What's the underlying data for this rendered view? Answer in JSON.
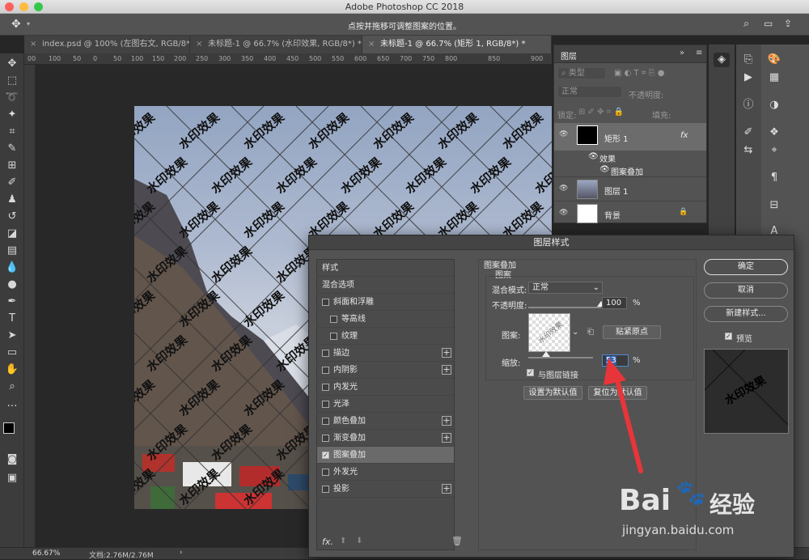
{
  "app": {
    "title": "Adobe Photoshop CC 2018",
    "hint": "点按并拖移可调整图案的位置。"
  },
  "tabs": [
    {
      "label": "index.psd @ 100% (左图右文, RGB/8*)"
    },
    {
      "label": "未标题-1 @ 66.7% (水印效果, RGB/8*) *"
    },
    {
      "label": "未标题-1 @ 66.7% (矩形 1, RGB/8*) *"
    }
  ],
  "ruler": [
    "00",
    "100",
    "50",
    "0",
    "50",
    "100",
    "150",
    "200",
    "250",
    "300",
    "350",
    "400",
    "450",
    "500",
    "550",
    "600",
    "650",
    "700",
    "750",
    "800",
    "850",
    "900"
  ],
  "watermark_text": "水印效果",
  "layers_panel": {
    "title": "图层",
    "filter_label": "类型",
    "blend_mode": "正常",
    "opacity_label": "不透明度:",
    "lock_label": "锁定:",
    "fill_label": "填充:",
    "fx_label": "fx",
    "layers": [
      {
        "name": "矩形 1"
      },
      {
        "name": "效果"
      },
      {
        "name": "图案叠加"
      },
      {
        "name": "图层 1"
      },
      {
        "name": "背景"
      }
    ]
  },
  "status": {
    "zoom": "66.67%",
    "doc": "文档:2.76M/2.76M"
  },
  "dialog": {
    "title": "图层样式",
    "styles": [
      {
        "label": "样式",
        "checkbox": false,
        "plus": false,
        "checked": false,
        "indent": 0
      },
      {
        "label": "混合选项",
        "checkbox": false,
        "plus": false,
        "checked": false,
        "indent": 0
      },
      {
        "label": "斜面和浮雕",
        "checkbox": true,
        "plus": false,
        "checked": false,
        "indent": 0
      },
      {
        "label": "等高线",
        "checkbox": true,
        "plus": false,
        "checked": false,
        "indent": 1
      },
      {
        "label": "纹理",
        "checkbox": true,
        "plus": false,
        "checked": false,
        "indent": 1
      },
      {
        "label": "描边",
        "checkbox": true,
        "plus": true,
        "checked": false,
        "indent": 0
      },
      {
        "label": "内阴影",
        "checkbox": true,
        "plus": true,
        "checked": false,
        "indent": 0
      },
      {
        "label": "内发光",
        "checkbox": true,
        "plus": false,
        "checked": false,
        "indent": 0
      },
      {
        "label": "光泽",
        "checkbox": true,
        "plus": false,
        "checked": false,
        "indent": 0
      },
      {
        "label": "颜色叠加",
        "checkbox": true,
        "plus": true,
        "checked": false,
        "indent": 0
      },
      {
        "label": "渐变叠加",
        "checkbox": true,
        "plus": true,
        "checked": false,
        "indent": 0
      },
      {
        "label": "图案叠加",
        "checkbox": true,
        "plus": false,
        "checked": true,
        "indent": 0,
        "selected": true
      },
      {
        "label": "外发光",
        "checkbox": true,
        "plus": false,
        "checked": false,
        "indent": 0
      },
      {
        "label": "投影",
        "checkbox": true,
        "plus": true,
        "checked": false,
        "indent": 0
      }
    ],
    "section_title": "图案叠加",
    "subsection": "图案",
    "blend_label": "混合模式:",
    "blend_value": "正常",
    "opacity_label": "不透明度:",
    "opacity_value": "100",
    "opacity_fraction": 1.0,
    "pattern_label": "图案:",
    "snap_button": "贴紧原点",
    "scale_label": "缩放:",
    "scale_value": "53",
    "scale_fraction": 0.53,
    "percent": "%",
    "link_label": "与图层链接",
    "set_default": "设置为默认值",
    "reset_default": "复位为默认值",
    "ok": "确定",
    "cancel": "取消",
    "new_style": "新建样式...",
    "preview_label": "预览",
    "fx_label": "fx."
  },
  "baidu": {
    "logo": "Bai",
    "brand": "经验",
    "url": "jingyan.baidu.com"
  }
}
